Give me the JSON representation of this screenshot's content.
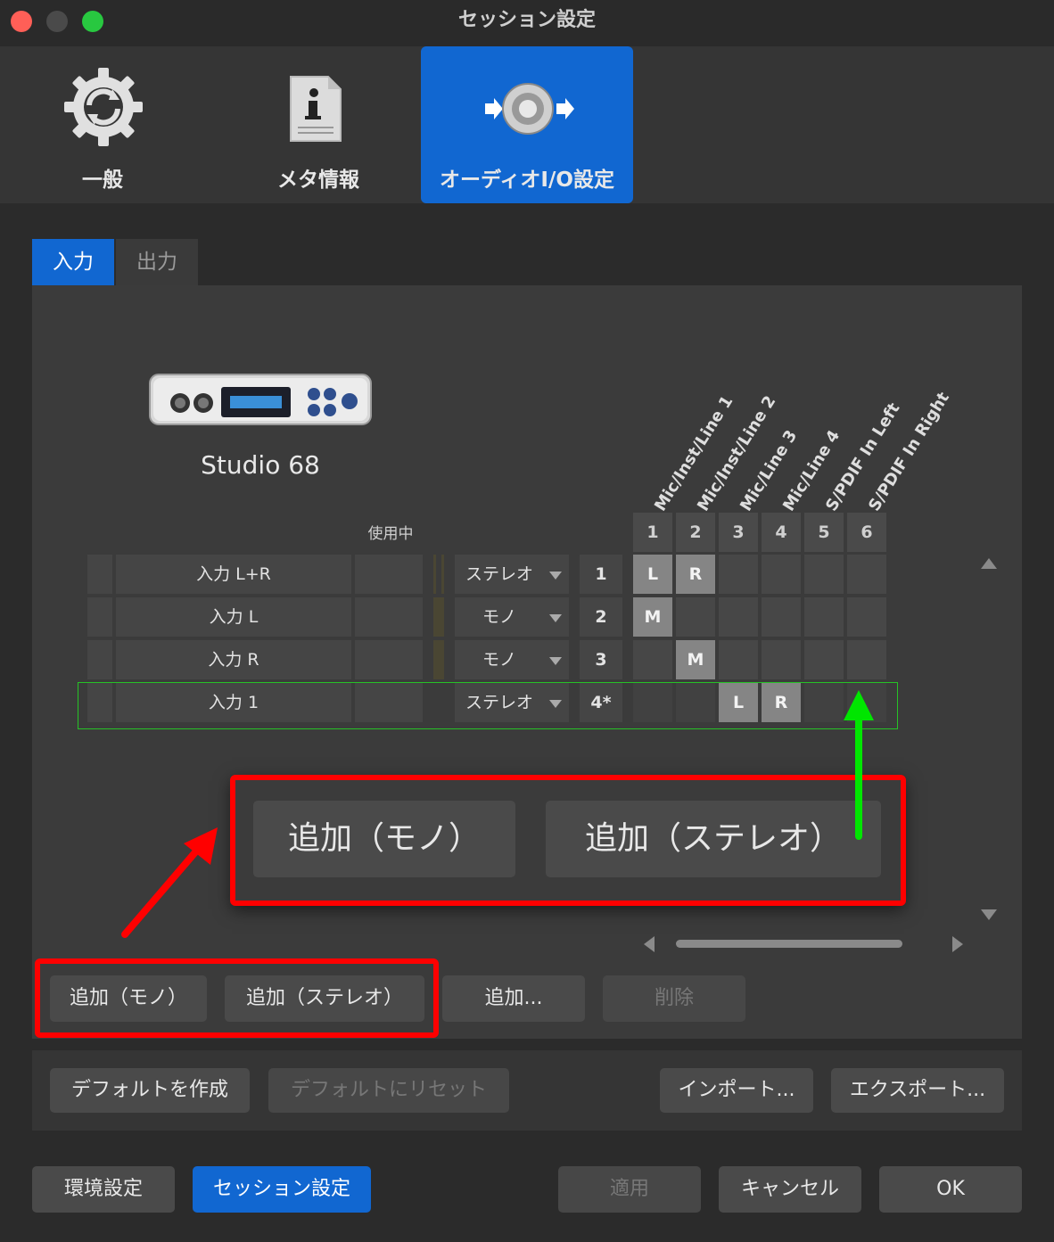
{
  "window": {
    "title": "セッション設定"
  },
  "toolbar": {
    "items": [
      {
        "label": "一般",
        "icon": "sync-gear-icon"
      },
      {
        "label": "メタ情報",
        "icon": "info-document-icon"
      },
      {
        "label": "オーディオI/O設定",
        "icon": "speaker-arrows-icon",
        "active": true
      }
    ]
  },
  "tabs": [
    {
      "label": "入力",
      "active": true
    },
    {
      "label": "出力"
    }
  ],
  "device": {
    "name": "Studio 68"
  },
  "matrix": {
    "in_use_label": "使用中",
    "columns": [
      {
        "num": "1",
        "name": "Mic/Inst/Line 1"
      },
      {
        "num": "2",
        "name": "Mic/Inst/Line 2"
      },
      {
        "num": "3",
        "name": "Mic/Line 3"
      },
      {
        "num": "4",
        "name": "Mic/Line 4"
      },
      {
        "num": "5",
        "name": "S/PDIF In Left"
      },
      {
        "num": "6",
        "name": "S/PDIF In Right"
      }
    ],
    "rows": [
      {
        "name": "入力 L+R",
        "type": "ステレオ",
        "index": "1",
        "assign": [
          "L",
          "R",
          "",
          "",
          "",
          ""
        ]
      },
      {
        "name": "入力 L",
        "type": "モノ",
        "index": "2",
        "assign": [
          "M",
          "",
          "",
          "",
          "",
          ""
        ]
      },
      {
        "name": "入力 R",
        "type": "モノ",
        "index": "3",
        "assign": [
          "",
          "M",
          "",
          "",
          "",
          ""
        ]
      },
      {
        "name": "入力 1",
        "type": "ステレオ",
        "index": "4*",
        "assign": [
          "",
          "",
          "L",
          "R",
          "",
          ""
        ]
      }
    ]
  },
  "zoom_callout": {
    "add_mono": "追加（モノ）",
    "add_stereo": "追加（ステレオ）"
  },
  "panel_buttons": {
    "add_mono": "追加（モノ）",
    "add_stereo": "追加（ステレオ）",
    "add_more": "追加...",
    "delete": "削除"
  },
  "preset_buttons": {
    "make_default": "デフォルトを作成",
    "reset_default": "デフォルトにリセット",
    "import": "インポート...",
    "export": "エクスポート..."
  },
  "footer_buttons": {
    "preferences": "環境設定",
    "session_settings": "セッション設定",
    "apply": "適用",
    "cancel": "キャンセル",
    "ok": "OK"
  },
  "colors": {
    "accent": "#1167d1",
    "annotation_red": "#ff0000",
    "annotation_green": "#00e600"
  }
}
